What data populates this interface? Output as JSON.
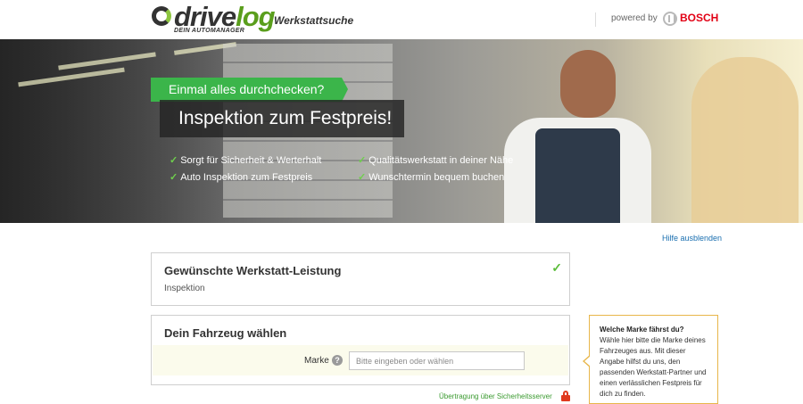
{
  "header": {
    "logo_text_a": "drive",
    "logo_text_b": "log",
    "logo_subtitle": "DEIN AUTOMANAGER",
    "page_label": "Werkstattsuche",
    "powered_by": "powered by",
    "partner": "BOSCH"
  },
  "hero": {
    "tagline": "Einmal alles durchchecken?",
    "headline": "Inspektion zum Festpreis!",
    "features": [
      "Sorgt für Sicherheit & Werterhalt",
      "Qualitätswerkstatt in deiner Nähe",
      "Auto Inspektion zum Festpreis",
      "Wunschtermin bequem buchen"
    ]
  },
  "help_toggle": "Hilfe ausblenden",
  "service_card": {
    "title": "Gewünschte Werkstatt-Leistung",
    "value": "Inspektion"
  },
  "vehicle_card": {
    "title": "Dein Fahrzeug wählen",
    "brand_label": "Marke",
    "brand_placeholder": "Bitte eingeben oder wählen",
    "help_symbol": "?"
  },
  "tip": {
    "title": "Welche Marke fährst du?",
    "body": "Wähle hier bitte die Marke deines Fahrzeuges aus. Mit dieser Angabe hilfst du uns, den passenden Werkstatt-Partner und einen verlässlichen Festpreis für dich zu finden."
  },
  "secure_note": "Übertragung über Sicherheitsserver",
  "colors": {
    "brand_green": "#3bb54a",
    "bosch_red": "#e20015",
    "link_blue": "#1a6fb0",
    "tip_border": "#e8b64a"
  }
}
